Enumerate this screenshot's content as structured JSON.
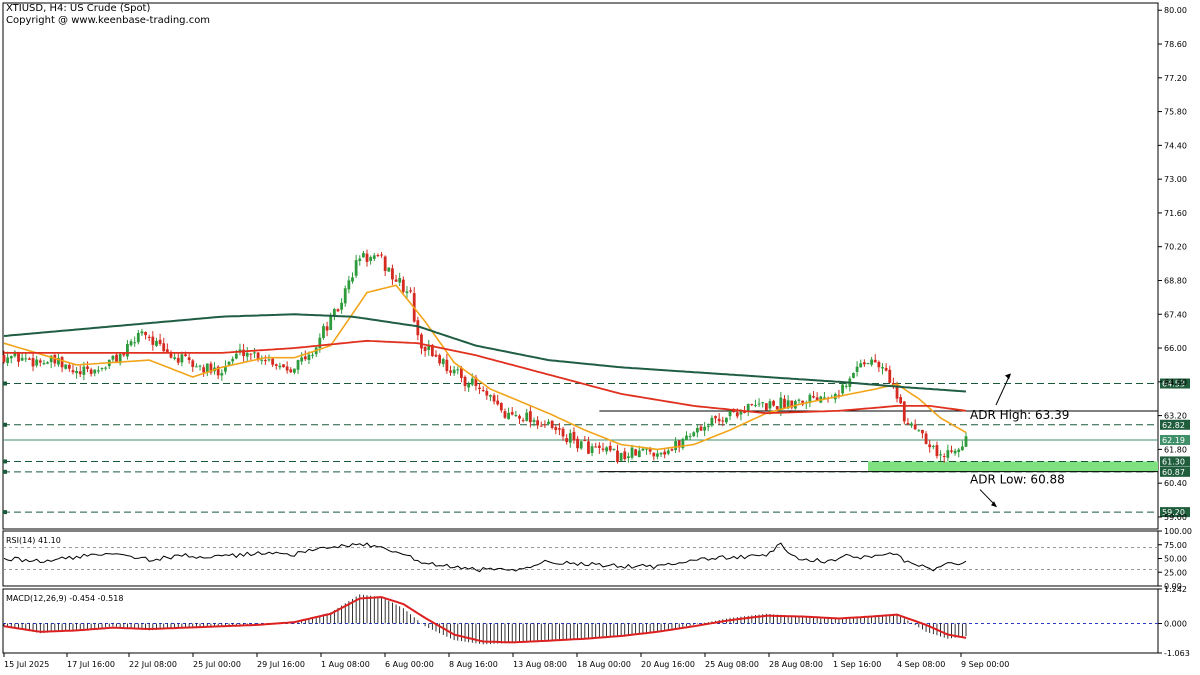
{
  "header": {
    "symbol_line": "XTIUSD, H4:  US Crude (Spot)",
    "copyright": "Copyright @ www.keenbase-trading.com"
  },
  "colors": {
    "candle_up": "#2e9b3c",
    "candle_down": "#d42a1f",
    "ma_fast": "#f2a51a",
    "ma_mid": "#e0301e",
    "ma_slow": "#1f5d44",
    "level_line": "#1a5a3a",
    "price_line": "#3f8f6a",
    "zone_fill": "#7fe07f",
    "macd_signal": "#dd1f1f"
  },
  "chart_data": [
    {
      "type": "candlestick",
      "title": "XTIUSD, H4:  US Crude (Spot)",
      "ylim": [
        58.5,
        80.3
      ],
      "y_ticks": [
        "80.00",
        "78.60",
        "77.20",
        "75.80",
        "74.40",
        "73.00",
        "71.60",
        "70.20",
        "68.80",
        "67.40",
        "66.00",
        "64.60",
        "63.20",
        "61.80",
        "60.40",
        "59.00"
      ],
      "x_ticks": [
        "15 Jul 2025",
        "17 Jul 16:00",
        "22 Jul 08:00",
        "25 Jul 00:00",
        "29 Jul 16:00",
        "1 Aug 08:00",
        "6 Aug 00:00",
        "8 Aug 16:00",
        "13 Aug 08:00",
        "18 Aug 00:00",
        "20 Aug 16:00",
        "25 Aug 08:00",
        "28 Aug 08:00",
        "1 Sep 16:00",
        "4 Sep 08:00",
        "9 Sep 00:00"
      ],
      "close_path": [
        [
          0,
          65.7
        ],
        [
          8,
          65.5
        ],
        [
          14,
          65.4
        ],
        [
          20,
          64.9
        ],
        [
          26,
          65.1
        ],
        [
          34,
          65.9
        ],
        [
          38,
          66.8
        ],
        [
          44,
          65.8
        ],
        [
          52,
          65.3
        ],
        [
          58,
          65.0
        ],
        [
          66,
          65.9
        ],
        [
          72,
          65.6
        ],
        [
          78,
          65.2
        ],
        [
          84,
          65.6
        ],
        [
          88,
          66.7
        ],
        [
          92,
          67.6
        ],
        [
          96,
          69.1
        ],
        [
          98,
          69.8
        ],
        [
          104,
          69.6
        ],
        [
          108,
          68.8
        ],
        [
          112,
          68.2
        ],
        [
          114,
          66.3
        ],
        [
          118,
          65.8
        ],
        [
          124,
          65.0
        ],
        [
          130,
          64.4
        ],
        [
          134,
          63.8
        ],
        [
          138,
          63.2
        ],
        [
          142,
          63.3
        ],
        [
          148,
          62.9
        ],
        [
          156,
          62.2
        ],
        [
          164,
          61.7
        ],
        [
          170,
          61.5
        ],
        [
          176,
          61.7
        ],
        [
          184,
          61.8
        ],
        [
          190,
          62.6
        ],
        [
          196,
          63.0
        ],
        [
          202,
          63.4
        ],
        [
          208,
          63.6
        ],
        [
          214,
          63.7
        ],
        [
          220,
          63.9
        ],
        [
          226,
          64.1
        ],
        [
          232,
          64.4
        ],
        [
          236,
          65.5
        ],
        [
          240,
          65.4
        ],
        [
          244,
          64.8
        ],
        [
          248,
          63.0
        ],
        [
          252,
          62.7
        ],
        [
          256,
          61.9
        ],
        [
          258,
          61.4
        ],
        [
          262,
          62.0
        ],
        [
          265,
          62.2
        ]
      ],
      "candle_count": 266,
      "series": [
        {
          "name": "MA fast",
          "points": [
            [
              0,
              66.2
            ],
            [
              20,
              65.3
            ],
            [
              40,
              65.5
            ],
            [
              52,
              64.8
            ],
            [
              60,
              65.2
            ],
            [
              72,
              65.6
            ],
            [
              80,
              65.6
            ],
            [
              90,
              66.1
            ],
            [
              100,
              68.3
            ],
            [
              108,
              68.6
            ],
            [
              116,
              67.1
            ],
            [
              124,
              65.4
            ],
            [
              134,
              64.3
            ],
            [
              150,
              63.3
            ],
            [
              160,
              62.6
            ],
            [
              170,
              62.0
            ],
            [
              180,
              61.8
            ],
            [
              190,
              62.0
            ],
            [
              200,
              62.6
            ],
            [
              210,
              63.3
            ],
            [
              220,
              63.7
            ],
            [
              230,
              64.0
            ],
            [
              240,
              64.3
            ],
            [
              246,
              64.5
            ],
            [
              252,
              63.9
            ],
            [
              258,
              63.1
            ],
            [
              265,
              62.5
            ]
          ]
        },
        {
          "name": "MA mid",
          "points": [
            [
              0,
              65.8
            ],
            [
              30,
              65.8
            ],
            [
              60,
              65.8
            ],
            [
              80,
              66.0
            ],
            [
              100,
              66.3
            ],
            [
              114,
              66.2
            ],
            [
              130,
              65.7
            ],
            [
              150,
              64.9
            ],
            [
              170,
              64.1
            ],
            [
              190,
              63.6
            ],
            [
              210,
              63.3
            ],
            [
              230,
              63.4
            ],
            [
              246,
              63.6
            ],
            [
              255,
              63.6
            ],
            [
              265,
              63.4
            ]
          ]
        },
        {
          "name": "MA slow",
          "points": [
            [
              0,
              66.5
            ],
            [
              30,
              66.9
            ],
            [
              60,
              67.3
            ],
            [
              80,
              67.4
            ],
            [
              96,
              67.3
            ],
            [
              114,
              66.9
            ],
            [
              130,
              66.1
            ],
            [
              150,
              65.5
            ],
            [
              170,
              65.2
            ],
            [
              190,
              65.0
            ],
            [
              210,
              64.8
            ],
            [
              230,
              64.6
            ],
            [
              246,
              64.4
            ],
            [
              265,
              64.2
            ]
          ]
        }
      ],
      "levels": [
        {
          "value": 64.53,
          "label": "64.53",
          "style": "dashed"
        },
        {
          "value": 62.82,
          "label": "62.82",
          "style": "dashed"
        },
        {
          "value": 62.19,
          "label": "62.19",
          "style": "current"
        },
        {
          "value": 61.3,
          "label": "61.30",
          "style": "dashed"
        },
        {
          "value": 60.87,
          "label": "60.87",
          "style": "dashed"
        },
        {
          "value": 59.2,
          "label": "59.20",
          "style": "dashed"
        }
      ],
      "support_zone": [
        60.87,
        61.3
      ],
      "range_lines": [
        63.39,
        60.88
      ],
      "annotations": [
        {
          "text": "ADR High: 63.39",
          "value": 63.39
        },
        {
          "text": "ADR Low: 60.88",
          "value": 60.88
        }
      ]
    },
    {
      "type": "line",
      "title": "RSI(14) 41.10",
      "ylim": [
        0,
        100
      ],
      "y_ticks": [
        "100.00",
        "75.00",
        "50.00",
        "25.00",
        "0.00"
      ],
      "levels": [
        70,
        30
      ],
      "series": [
        {
          "name": "RSI(14)",
          "points": [
            [
              0,
              50
            ],
            [
              10,
              45
            ],
            [
              20,
              52
            ],
            [
              30,
              62
            ],
            [
              40,
              48
            ],
            [
              50,
              55
            ],
            [
              60,
              52
            ],
            [
              70,
              60
            ],
            [
              80,
              58
            ],
            [
              90,
              70
            ],
            [
              96,
              76
            ],
            [
              100,
              74
            ],
            [
              106,
              66
            ],
            [
              112,
              52
            ],
            [
              116,
              40
            ],
            [
              124,
              34
            ],
            [
              130,
              30
            ],
            [
              140,
              28
            ],
            [
              150,
              45
            ],
            [
              160,
              40
            ],
            [
              170,
              36
            ],
            [
              180,
              35
            ],
            [
              190,
              48
            ],
            [
              200,
              52
            ],
            [
              210,
              55
            ],
            [
              214,
              76
            ],
            [
              218,
              52
            ],
            [
              226,
              44
            ],
            [
              232,
              55
            ],
            [
              238,
              52
            ],
            [
              244,
              62
            ],
            [
              248,
              46
            ],
            [
              252,
              38
            ],
            [
              256,
              30
            ],
            [
              260,
              42
            ],
            [
              265,
              41.1
            ]
          ]
        }
      ]
    },
    {
      "type": "bar",
      "title": "MACD(12,26,9) -0.454 -0.518",
      "ylim": [
        -1.063,
        1.242
      ],
      "y_ticks": [
        "1.242",
        "0.000",
        "-1.063"
      ],
      "series": [
        {
          "name": "MACD",
          "points": [
            [
              0,
              -0.1
            ],
            [
              10,
              -0.35
            ],
            [
              20,
              -0.25
            ],
            [
              30,
              -0.1
            ],
            [
              40,
              -0.25
            ],
            [
              50,
              -0.15
            ],
            [
              60,
              -0.1
            ],
            [
              70,
              -0.05
            ],
            [
              80,
              0.05
            ],
            [
              90,
              0.4
            ],
            [
              98,
              1.05
            ],
            [
              104,
              0.95
            ],
            [
              110,
              0.55
            ],
            [
              116,
              -0.1
            ],
            [
              124,
              -0.6
            ],
            [
              132,
              -0.75
            ],
            [
              140,
              -0.7
            ],
            [
              150,
              -0.6
            ],
            [
              160,
              -0.55
            ],
            [
              170,
              -0.45
            ],
            [
              180,
              -0.3
            ],
            [
              190,
              -0.05
            ],
            [
              200,
              0.2
            ],
            [
              210,
              0.35
            ],
            [
              220,
              0.25
            ],
            [
              230,
              0.15
            ],
            [
              240,
              0.3
            ],
            [
              246,
              0.35
            ],
            [
              254,
              -0.3
            ],
            [
              260,
              -0.55
            ],
            [
              265,
              -0.454
            ]
          ]
        },
        {
          "name": "Signal",
          "points": [
            [
              0,
              -0.1
            ],
            [
              10,
              -0.3
            ],
            [
              20,
              -0.25
            ],
            [
              30,
              -0.15
            ],
            [
              40,
              -0.2
            ],
            [
              50,
              -0.15
            ],
            [
              60,
              -0.1
            ],
            [
              70,
              -0.05
            ],
            [
              80,
              0.05
            ],
            [
              90,
              0.35
            ],
            [
              98,
              0.9
            ],
            [
              104,
              0.95
            ],
            [
              110,
              0.7
            ],
            [
              116,
              0.2
            ],
            [
              124,
              -0.4
            ],
            [
              132,
              -0.65
            ],
            [
              140,
              -0.68
            ],
            [
              150,
              -0.62
            ],
            [
              160,
              -0.55
            ],
            [
              170,
              -0.45
            ],
            [
              180,
              -0.3
            ],
            [
              190,
              -0.1
            ],
            [
              200,
              0.12
            ],
            [
              210,
              0.28
            ],
            [
              220,
              0.25
            ],
            [
              230,
              0.18
            ],
            [
              240,
              0.26
            ],
            [
              246,
              0.32
            ],
            [
              254,
              -0.05
            ],
            [
              260,
              -0.4
            ],
            [
              265,
              -0.518
            ]
          ]
        }
      ]
    }
  ]
}
